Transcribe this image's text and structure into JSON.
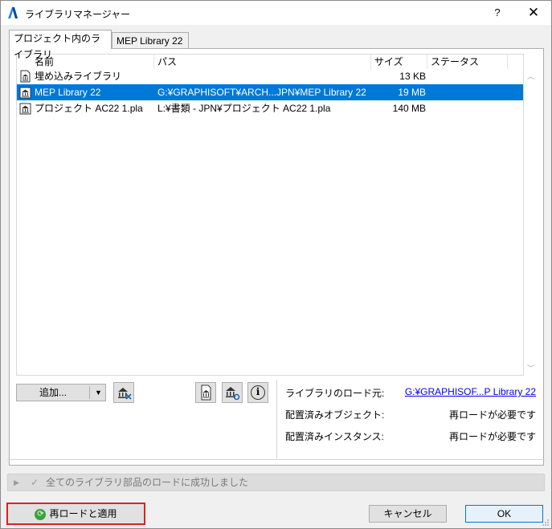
{
  "window": {
    "title": "ライブラリマネージャー",
    "help_label": "?",
    "close_label": "✕"
  },
  "tabs": [
    {
      "label": "プロジェクト内のライブラリ",
      "active": true
    },
    {
      "label": "MEP Library 22",
      "active": false
    }
  ],
  "list": {
    "columns": {
      "name": "名前",
      "path": "パス",
      "size": "サイズ",
      "status": "ステータス"
    },
    "rows": [
      {
        "name": "埋め込みライブラリ",
        "path": "",
        "size": "13 KB",
        "status": "",
        "selected": false
      },
      {
        "name": "MEP Library 22",
        "path": "G:¥GRAPHISOFT¥ARCH...JPN¥MEP Library 22",
        "size": "19 MB",
        "status": "",
        "selected": true
      },
      {
        "name": "プロジェクト AC22 1.pla",
        "path": "L:¥書類 - JPN¥プロジェクト AC22 1.pla",
        "size": "140 MB",
        "status": "",
        "selected": false
      }
    ]
  },
  "toolbar": {
    "add_label": "追加...",
    "dropdown_arrow": "▼",
    "info_label": "i"
  },
  "info": {
    "load_source_label": "ライブラリのロード元:",
    "load_source_value": "G:¥GRAPHISOF...P Library 22",
    "placed_objects_label": "配置済みオブジェクト:",
    "placed_objects_value": "再ロードが必要です",
    "placed_instances_label": "配置済みインスタンス:",
    "placed_instances_value": "再ロードが必要です"
  },
  "status": {
    "text": "全てのライブラリ部品のロードに成功しました"
  },
  "footer": {
    "reload_label": "再ロードと適用",
    "cancel_label": "キャンセル",
    "ok_label": "OK"
  },
  "colors": {
    "selection": "#0078d7",
    "highlight_border": "#e02020",
    "link": "#0000ee"
  }
}
